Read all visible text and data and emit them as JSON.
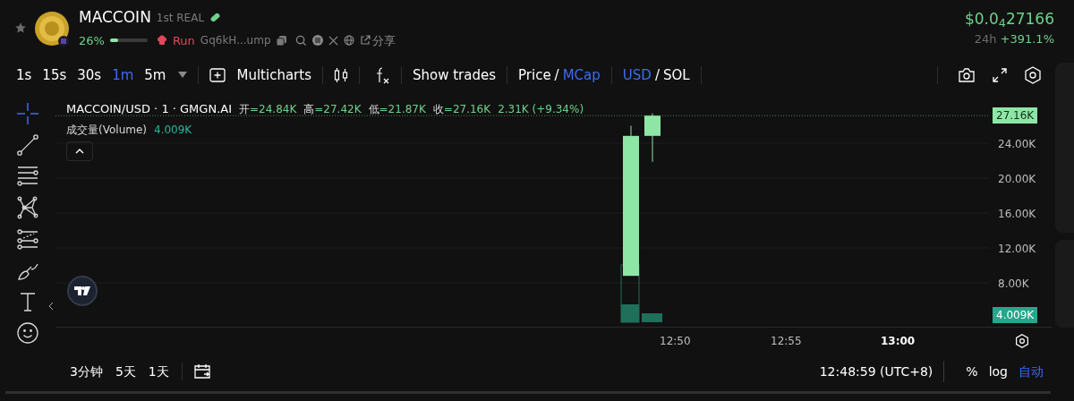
{
  "token": {
    "name": "MACCOIN",
    "tag": "1st REAL",
    "percent": "26%",
    "progress": {
      "level": 0.22
    },
    "status": "Run",
    "address": "Gq6kH...ump",
    "share": "分享"
  },
  "price": {
    "value": "$0.0$_{4}$27166",
    "period": "24h",
    "change": "+391.1%"
  },
  "intervals": [
    {
      "label": "1s",
      "selected": false
    },
    {
      "label": "15s",
      "selected": false
    },
    {
      "label": "30s",
      "selected": false
    },
    {
      "label": "1m",
      "selected": true
    },
    {
      "label": "5m",
      "selected": false
    }
  ],
  "multicharts": "Multicharts",
  "show_trades": "Show trades",
  "price_mode": {
    "separator": "/",
    "options": [
      {
        "label": "Price",
        "selected": false
      },
      {
        "label": "MCap",
        "selected": true
      }
    ]
  },
  "currency": {
    "separator": "/",
    "options": [
      {
        "label": "USD",
        "selected": true
      },
      {
        "label": "SOL",
        "selected": false
      }
    ]
  },
  "tools": [
    {
      "kind": "crosshair",
      "selected": true
    },
    {
      "kind": "trendline",
      "selected": false
    },
    {
      "kind": "lines",
      "selected": false
    },
    {
      "kind": "pattern",
      "selected": false
    },
    {
      "kind": "forecast",
      "selected": false
    },
    {
      "kind": "brush",
      "selected": false
    },
    {
      "kind": "text",
      "selected": false
    },
    {
      "kind": "emoji",
      "selected": false
    }
  ],
  "legend": {
    "title": "MACCOIN/USD · 1 · GMGN.AI",
    "ohlc": [
      {
        "label": "开",
        "value": "=24.84K"
      },
      {
        "label": "高",
        "value": "=27.42K"
      },
      {
        "label": "低",
        "value": "=21.87K"
      },
      {
        "label": "收",
        "value": "=27.16K"
      }
    ],
    "change": "2.31K (+9.34%)",
    "volume_label": "成交量(Volume)",
    "volume_value": "4.009K"
  },
  "price_axis": {
    "ticks": [
      "24.00K",
      "20.00K",
      "16.00K",
      "12.00K",
      "8.00K"
    ],
    "last_price": "27.16K",
    "last_volume": "4.009K"
  },
  "time_axis": [
    {
      "label": "12:50",
      "bold": false
    },
    {
      "label": "12:55",
      "bold": false
    },
    {
      "label": "13:00",
      "bold": true
    }
  ],
  "ranges": [
    "3分钟",
    "5天",
    "1天"
  ],
  "clock": "12:48:59 (UTC+8)",
  "scale_modes": [
    {
      "label": "%",
      "selected": false
    },
    {
      "label": "log",
      "selected": false
    },
    {
      "label": "自动",
      "selected": true
    }
  ]
}
